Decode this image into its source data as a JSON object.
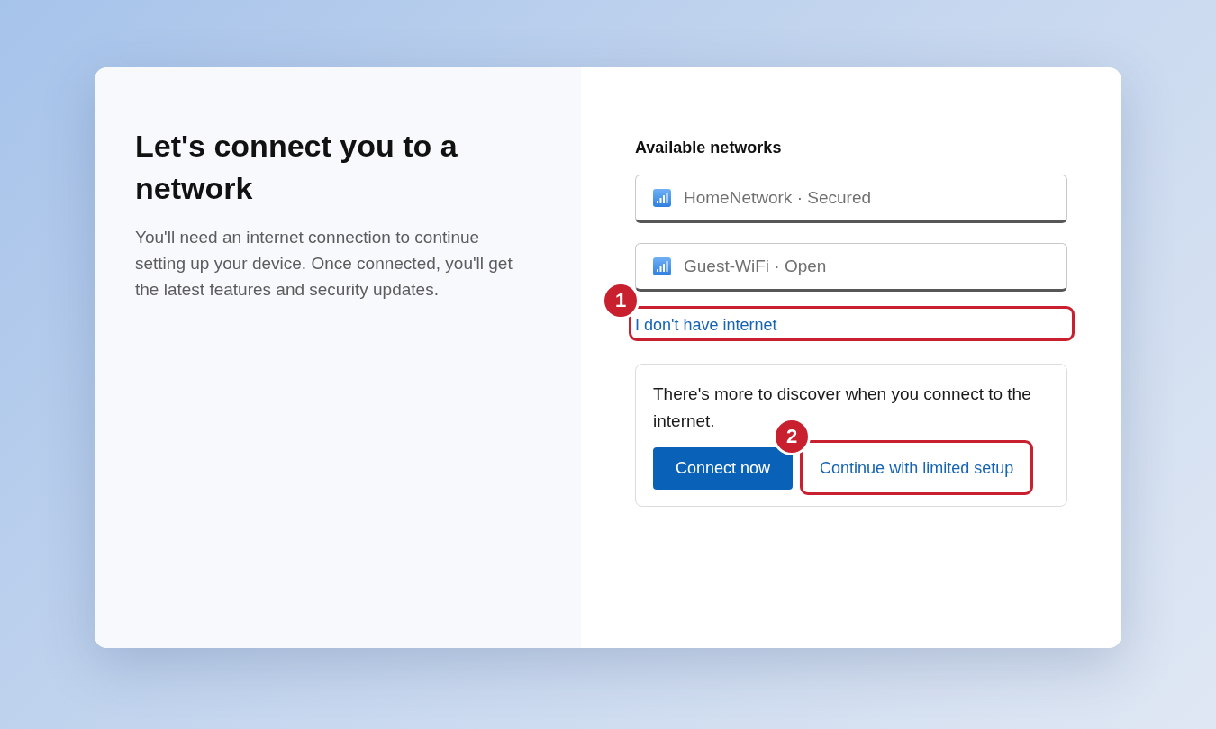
{
  "intro": {
    "title": "Let's connect you to a network",
    "description": "You'll need an internet connection to continue setting up your device. Once connected, you'll get the latest features and security updates."
  },
  "networks_panel": {
    "heading": "Available networks",
    "networks": [
      {
        "name": "HomeNetwork · Secured"
      },
      {
        "name": "Guest-WiFi · Open"
      }
    ],
    "no_internet_link": {
      "label": "I don't have internet",
      "callout": "1"
    },
    "notice": {
      "text": "There's more to discover when you connect to the internet.",
      "buttons": [
        {
          "label": "Connect now",
          "kind": "primary"
        },
        {
          "label": "Continue with limited setup",
          "kind": "text",
          "callout": "2"
        }
      ]
    }
  }
}
